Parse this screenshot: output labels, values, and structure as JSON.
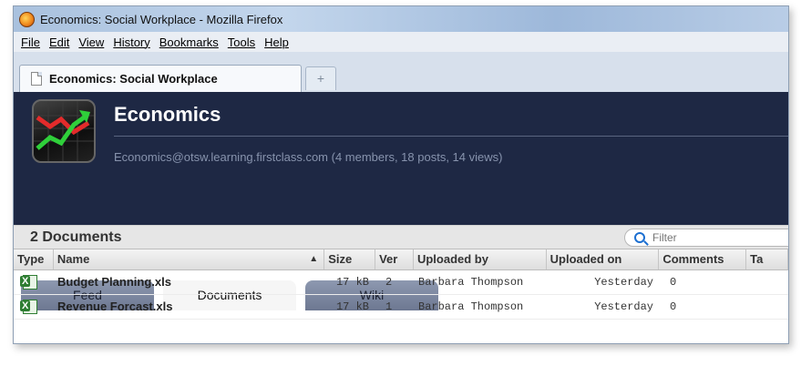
{
  "window": {
    "title": "Economics: Social Workplace - Mozilla Firefox"
  },
  "menu": [
    "File",
    "Edit",
    "View",
    "History",
    "Bookmarks",
    "Tools",
    "Help"
  ],
  "browser_tab": {
    "label": "Economics: Social Workplace",
    "new_tab": "+"
  },
  "header": {
    "title": "Economics",
    "subtitle": "Economics@otsw.learning.firstclass.com (4 members, 18 posts, 14 views)"
  },
  "page_tabs": [
    {
      "label": "Feed",
      "active": false
    },
    {
      "label": "Documents",
      "active": true
    },
    {
      "label": "Wiki",
      "active": false
    }
  ],
  "documents": {
    "count_label": "2 Documents",
    "filter_placeholder": "Filter",
    "columns": [
      "Type",
      "Name",
      "Size",
      "Ver",
      "Uploaded by",
      "Uploaded on",
      "Comments",
      "Ta"
    ],
    "rows": [
      {
        "type_icon": "excel-file-icon",
        "name": "Budget Planning.xls",
        "size": "17 kB",
        "ver": "2",
        "uploaded_by": "Barbara Thompson",
        "uploaded_on": "Yesterday",
        "comments": "0"
      },
      {
        "type_icon": "excel-file-icon",
        "name": "Revenue Forcast.xls",
        "size": "17 kB",
        "ver": "1",
        "uploaded_by": "Barbara Thompson",
        "uploaded_on": "Yesterday",
        "comments": "0"
      }
    ]
  },
  "colors": {
    "header_bg": "#1e2844",
    "title_bar": "#a9c1de",
    "excel_green": "#2e7d32"
  }
}
